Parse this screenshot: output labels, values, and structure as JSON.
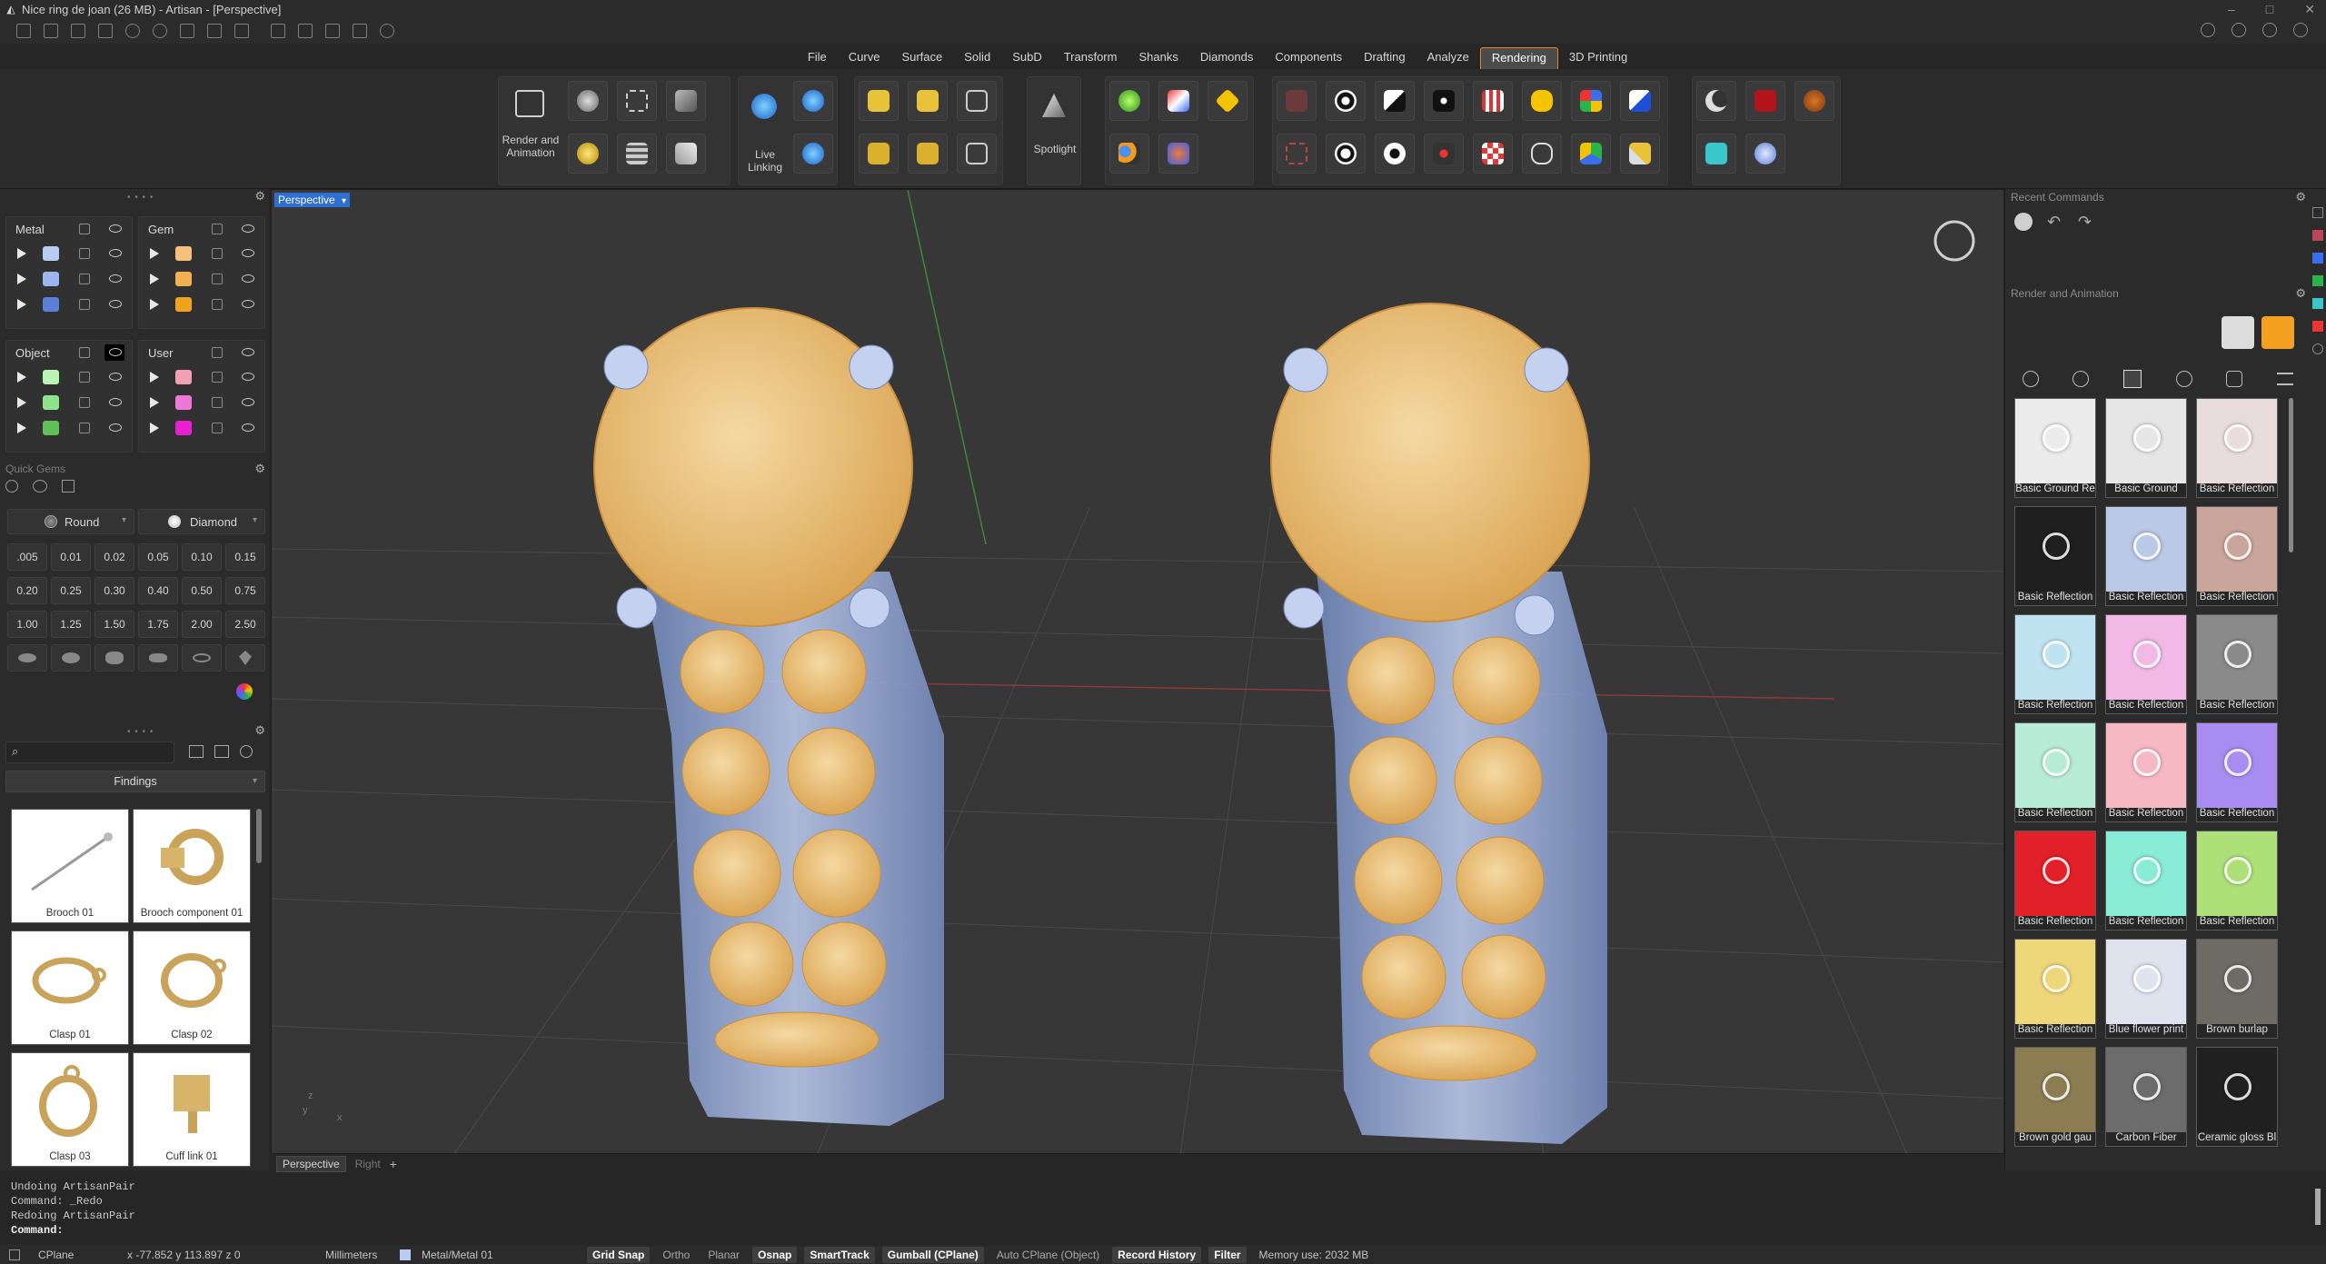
{
  "window": {
    "title": "Nice ring de joan (26 MB) - Artisan - [Perspective]",
    "controls": [
      "–",
      "□",
      "✕"
    ]
  },
  "menu": {
    "tabs": [
      "File",
      "Curve",
      "Surface",
      "Solid",
      "SubD",
      "Transform",
      "Shanks",
      "Diamonds",
      "Components",
      "Drafting",
      "Analyze",
      "Rendering",
      "3D Printing"
    ],
    "active": "Rendering"
  },
  "ribbon": {
    "render_animation_label": "Render and Animation",
    "live_linking_label": "Live Linking",
    "spotlight_label": "Spotlight"
  },
  "layers": {
    "metal": {
      "title": "Metal",
      "colors": [
        "#b8ccf5",
        "#9bb6ef",
        "#5b7fd6"
      ]
    },
    "gem": {
      "title": "Gem",
      "colors": [
        "#f6c27a",
        "#f3b04e",
        "#f0a21c"
      ]
    },
    "object": {
      "title": "Object",
      "colors": [
        "#b9f3b6",
        "#8fe38a",
        "#5fc05a"
      ]
    },
    "user": {
      "title": "User",
      "colors": [
        "#f3a0b5",
        "#ef77d8",
        "#e820d0"
      ]
    }
  },
  "quick_gems": {
    "title": "Quick Gems",
    "shape": "Round",
    "material": "Diamond",
    "sizes_row1": [
      ".005",
      "0.01",
      "0.02",
      "0.05",
      "0.10",
      "0.15"
    ],
    "sizes_row2": [
      "0.20",
      "0.25",
      "0.30",
      "0.40",
      "0.50",
      "0.75"
    ],
    "sizes_row3": [
      "1.00",
      "1.25",
      "1.50",
      "1.75",
      "2.00",
      "2.50"
    ]
  },
  "library": {
    "category": "Findings",
    "items": [
      "Brooch 01",
      "Brooch component 01",
      "Clasp 01",
      "Clasp 02",
      "Clasp 03",
      "Cuff link 01"
    ]
  },
  "viewport": {
    "active_label": "Perspective",
    "tabs": [
      "Perspective",
      "Right"
    ],
    "axis": {
      "z": "z",
      "y": "y",
      "x": "x"
    }
  },
  "right_panel": {
    "recent_commands_title": "Recent Commands",
    "render_title": "Render and Animation",
    "materials": [
      {
        "label": "Basic Ground Re",
        "bg": "#ececec"
      },
      {
        "label": "Basic Ground",
        "bg": "#e6e6e6"
      },
      {
        "label": "Basic Reflection",
        "bg": "#e9dcdc"
      },
      {
        "label": "Basic Reflection",
        "bg": "#1f1f1f"
      },
      {
        "label": "Basic Reflection",
        "bg": "#b9c9e6"
      },
      {
        "label": "Basic Reflection",
        "bg": "#c9a59b"
      },
      {
        "label": "Basic Reflection",
        "bg": "#bfe3f1"
      },
      {
        "label": "Basic Reflection",
        "bg": "#f2b9e6"
      },
      {
        "label": "Basic Reflection",
        "bg": "#8a8a8a"
      },
      {
        "label": "Basic Reflection",
        "bg": "#b7ecd9"
      },
      {
        "label": "Basic Reflection",
        "bg": "#f6b9c4"
      },
      {
        "label": "Basic Reflection",
        "bg": "#a98cf0"
      },
      {
        "label": "Basic Reflection",
        "bg": "#e2202a"
      },
      {
        "label": "Basic Reflection",
        "bg": "#88ecd6"
      },
      {
        "label": "Basic Reflection",
        "bg": "#aee07a"
      },
      {
        "label": "Basic Reflection",
        "bg": "#eed67a"
      },
      {
        "label": "Blue flower print",
        "bg": "#dfe3ee"
      },
      {
        "label": "Brown burlap",
        "bg": "#6e6a64"
      },
      {
        "label": "Brown gold gau",
        "bg": "#8c7c52"
      },
      {
        "label": "Carbon Fiber",
        "bg": "#6c6c6c"
      },
      {
        "label": "Ceramic gloss Bl",
        "bg": "#202020"
      }
    ]
  },
  "command_log": [
    "Undoing ArtisanPair",
    "Command: _Redo",
    "Redoing ArtisanPair"
  ],
  "command_prompt": "Command:",
  "status": {
    "cplane": "CPlane",
    "coords": "x -77.852  y 113.897  z 0",
    "units": "Millimeters",
    "layer": "Metal/Metal 01",
    "toggles": [
      {
        "label": "Grid Snap",
        "on": true
      },
      {
        "label": "Ortho",
        "on": false
      },
      {
        "label": "Planar",
        "on": false
      },
      {
        "label": "Osnap",
        "on": true
      },
      {
        "label": "SmartTrack",
        "on": true
      },
      {
        "label": "Gumball (CPlane)",
        "on": true
      },
      {
        "label": "Auto CPlane (Object)",
        "on": false
      },
      {
        "label": "Record History",
        "on": true
      },
      {
        "label": "Filter",
        "on": true
      }
    ],
    "memory": "Memory use: 2032 MB"
  }
}
